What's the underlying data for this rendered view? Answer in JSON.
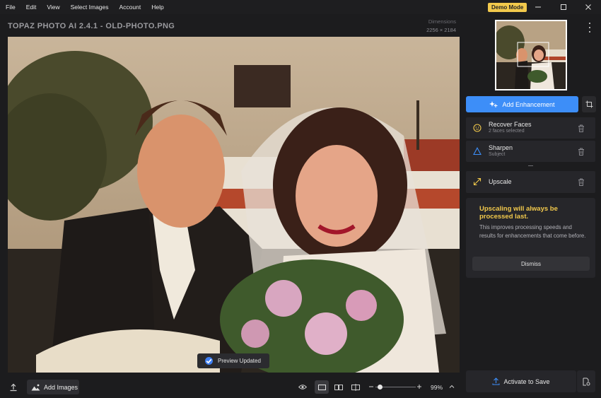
{
  "menu": [
    "File",
    "Edit",
    "View",
    "Select Images",
    "Account",
    "Help"
  ],
  "demo_badge": "Demo Mode",
  "window_controls": [
    "minimize-icon",
    "maximize-icon",
    "close-icon"
  ],
  "document": {
    "title": "TOPAZ PHOTO AI 2.4.1 - OLD-PHOTO.PNG",
    "dimensions_label": "Dimensions",
    "dimensions_value": "2256 × 2184"
  },
  "toast": "Preview Updated",
  "bottom_bar": {
    "add_images_label": "Add Images",
    "zoom_level": "99%",
    "zoom_fraction": 0.12,
    "view_modes": [
      "eye-icon",
      "single-view-icon",
      "side-by-side-icon",
      "split-view-icon"
    ]
  },
  "panel": {
    "add_enhancement_label": "Add Enhancement",
    "enhancements": [
      {
        "title": "Recover Faces",
        "subtitle": "2 faces selected",
        "icon": "face-icon",
        "color": "#f2c94c"
      },
      {
        "title": "Sharpen",
        "subtitle": "Subject",
        "icon": "triangle-icon",
        "color": "#3d8ef8"
      },
      {
        "title": "Upscale",
        "subtitle": "",
        "icon": "expand-arrows-icon",
        "color": "#f2c94c"
      }
    ],
    "note": {
      "title": "Upscaling will always be processed last.",
      "body": "This improves processing speeds and results for enhancements that come before.",
      "dismiss_label": "Dismiss"
    },
    "activate_label": "Activate to Save"
  },
  "colors": {
    "accent": "#3d8ef8",
    "warning": "#f2c94c",
    "background": "#1c1c1e",
    "card": "#26262a"
  }
}
